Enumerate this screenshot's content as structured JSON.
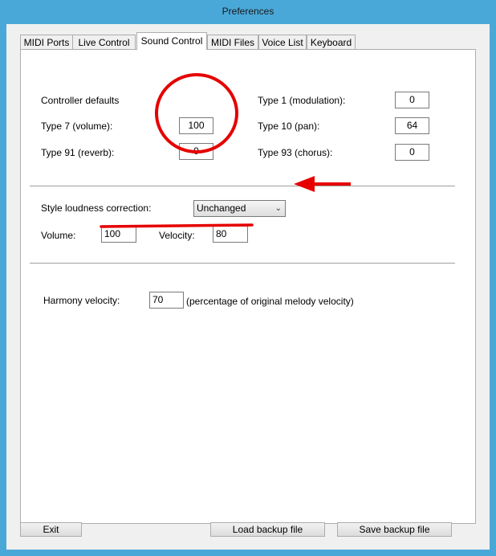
{
  "window": {
    "title": "Preferences"
  },
  "tabs": [
    {
      "label": "MIDI Ports"
    },
    {
      "label": "Live Control"
    },
    {
      "label": "Sound Control"
    },
    {
      "label": "MIDI Files"
    },
    {
      "label": "Voice List"
    },
    {
      "label": "Keyboard"
    }
  ],
  "active_tab": "Sound Control",
  "controller": {
    "heading": "Controller defaults",
    "type7_label": "Type 7 (volume):",
    "type7_value": "100",
    "type91_label": "Type 91 (reverb):",
    "type91_value": "0",
    "type1_label": "Type 1 (modulation):",
    "type1_value": "0",
    "type10_label": "Type 10 (pan):",
    "type10_value": "64",
    "type93_label": "Type 93 (chorus):",
    "type93_value": "0"
  },
  "loudness": {
    "label": "Style loudness correction:",
    "selected": "Unchanged",
    "volume_label": "Volume:",
    "volume_value": "100",
    "velocity_label": "Velocity:",
    "velocity_value": "80"
  },
  "harmony": {
    "label": "Harmony velocity:",
    "value": "70",
    "note": "(percentage of original melody velocity)"
  },
  "buttons": {
    "exit": "Exit",
    "load": "Load backup file",
    "save": "Save backup file"
  },
  "annotation_color": "#e60000"
}
